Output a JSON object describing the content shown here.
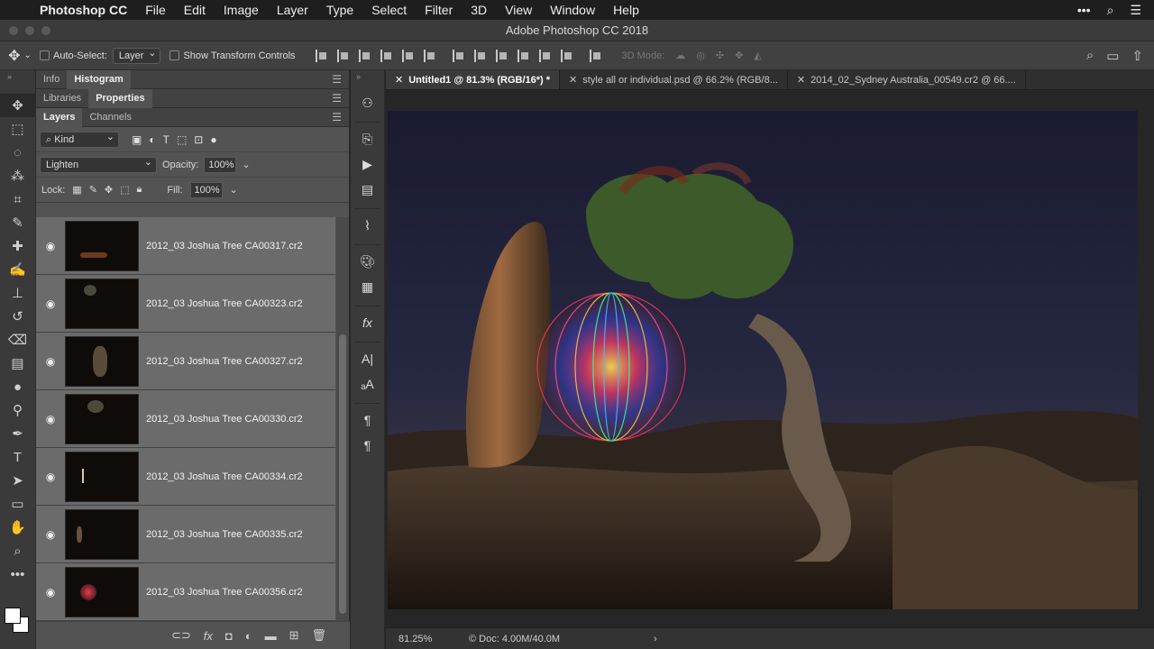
{
  "menubar": {
    "app": "Photoshop CC",
    "items": [
      "File",
      "Edit",
      "Image",
      "Layer",
      "Type",
      "Select",
      "Filter",
      "3D",
      "View",
      "Window",
      "Help"
    ],
    "right_icons": [
      "more-icon",
      "search-icon",
      "menu-icon"
    ]
  },
  "window": {
    "title": "Adobe Photoshop CC 2018"
  },
  "options": {
    "auto_select_label": "Auto-Select:",
    "auto_select_value": "Layer",
    "transform_label": "Show Transform Controls",
    "mode_3d": "3D Mode:"
  },
  "panels": {
    "tabs_row1": [
      "Info",
      "Histogram"
    ],
    "tabs_row2": [
      "Libraries",
      "Properties"
    ],
    "tabs_row3": [
      "Layers",
      "Channels"
    ],
    "kind_label": "Kind",
    "blend_mode": "Lighten",
    "opacity_label": "Opacity:",
    "opacity_value": "100%",
    "lock_label": "Lock:",
    "fill_label": "Fill:",
    "fill_value": "100%"
  },
  "layers": [
    {
      "name": "2012_03 Joshua Tree CA00317.cr2"
    },
    {
      "name": "2012_03 Joshua Tree CA00323.cr2"
    },
    {
      "name": "2012_03 Joshua Tree CA00327.cr2"
    },
    {
      "name": "2012_03 Joshua Tree CA00330.cr2"
    },
    {
      "name": "2012_03 Joshua Tree CA00334.cr2"
    },
    {
      "name": "2012_03 Joshua Tree CA00335.cr2"
    },
    {
      "name": "2012_03 Joshua Tree CA00356.cr2"
    }
  ],
  "doc_tabs": [
    {
      "label": "Untitled1 @ 81.3% (RGB/16*) *",
      "active": true
    },
    {
      "label": "style all or individual.psd @ 66.2% (RGB/8...",
      "active": false
    },
    {
      "label": "2014_02_Sydney Australia_00549.cr2 @ 66....",
      "active": false
    }
  ],
  "status": {
    "zoom": "81.25%",
    "doc": "Doc: 4.00M/40.0M"
  },
  "colors": {
    "accent": "#535353",
    "canvas_bg": "#262626"
  }
}
